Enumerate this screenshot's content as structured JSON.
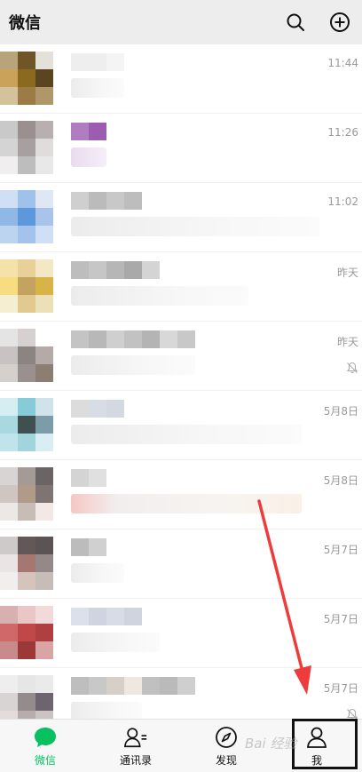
{
  "header": {
    "title": "微信",
    "icons": [
      "search-icon",
      "plus-circle-icon"
    ]
  },
  "chats": [
    {
      "time": "11:44",
      "muted": false
    },
    {
      "time": "11:26",
      "muted": false
    },
    {
      "time": "11:02",
      "muted": false
    },
    {
      "time": "昨天",
      "muted": false
    },
    {
      "time": "昨天",
      "muted": true
    },
    {
      "time": "5月8日",
      "muted": false
    },
    {
      "time": "5月8日",
      "muted": false
    },
    {
      "time": "5月7日",
      "muted": false
    },
    {
      "time": "5月7日",
      "muted": false
    },
    {
      "time": "5月7日",
      "muted": true
    }
  ],
  "tabbar": {
    "active": "chats",
    "tabs": [
      {
        "key": "chats",
        "label": "微信",
        "icon": "chat-bubble-icon"
      },
      {
        "key": "contacts",
        "label": "通讯录",
        "icon": "contacts-icon"
      },
      {
        "key": "discover",
        "label": "发现",
        "icon": "compass-icon"
      },
      {
        "key": "me",
        "label": "我",
        "icon": "person-icon"
      }
    ]
  },
  "colors": {
    "accent": "#07c160",
    "annotation_arrow": "#ee3b3b"
  },
  "watermark": "Bai 经验"
}
